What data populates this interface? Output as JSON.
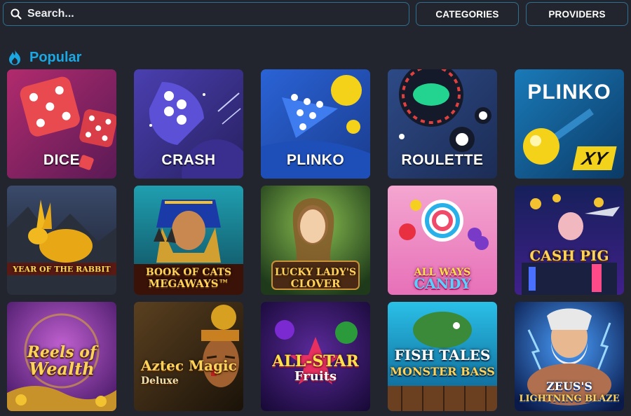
{
  "search": {
    "placeholder": "Search..."
  },
  "filters": {
    "categories_label": "CATEGORIES",
    "providers_label": "PROVIDERS"
  },
  "section": {
    "title": "Popular",
    "icon": "fire-icon"
  },
  "colors": {
    "accent": "#1ba7e2",
    "border": "#2f6f8f",
    "background": "#23252e"
  },
  "games": [
    {
      "label": "DICE"
    },
    {
      "label": "CRASH"
    },
    {
      "label": "PLINKO"
    },
    {
      "label": "ROULETTE"
    },
    {
      "logo": "PLINKO",
      "badge": "XY"
    },
    {
      "line1": "YEAR OF THE RABBIT",
      "line2": ""
    },
    {
      "line1": "BOOK OF CATS",
      "line2": "MEGAWAYS™"
    },
    {
      "line1": "LUCKY LADY'S",
      "line2": "CLOVER"
    },
    {
      "line1": "ALL WAYS",
      "line2": "CANDY"
    },
    {
      "line1": "CASH PIG",
      "line2": ""
    },
    {
      "line1": "Reels of",
      "line2": "Wealth"
    },
    {
      "line1": "Aztec Magic",
      "line2": "Deluxe"
    },
    {
      "line1": "ALL-STAR",
      "line2": "Fruits"
    },
    {
      "line1": "FISH TALES",
      "line2": "MONSTER BASS"
    },
    {
      "line1": "ZEUS'S",
      "line2": "LIGHTNING BLAZE"
    }
  ]
}
